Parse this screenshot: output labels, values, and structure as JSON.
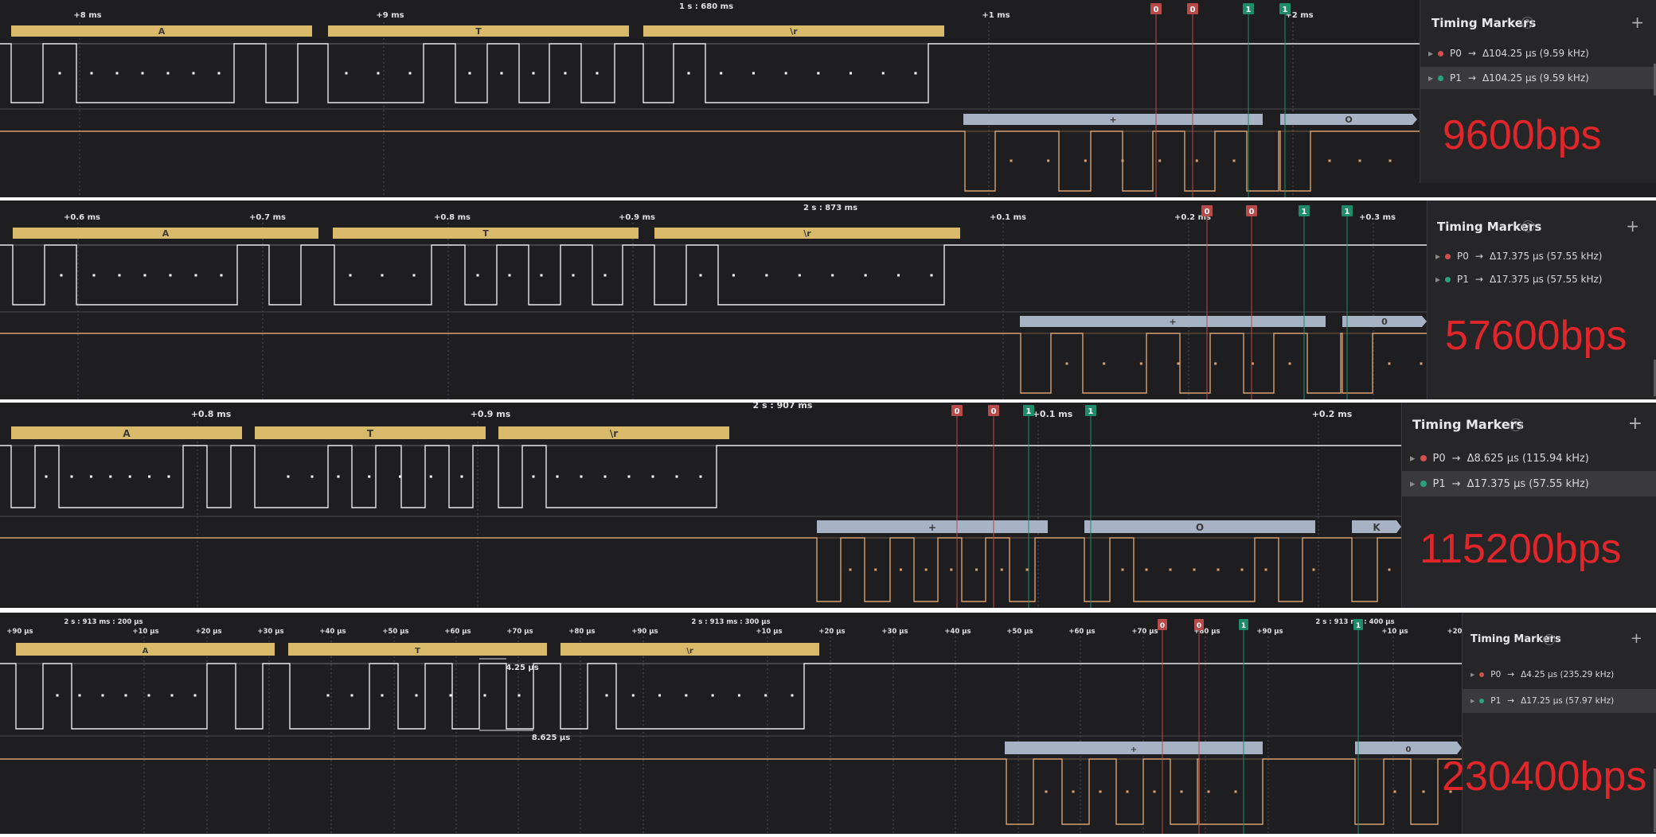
{
  "colors": {
    "panel_bg": "#1e1e20",
    "frame_bg": "#ffffff",
    "signal_white": "#e8e8e8",
    "signal_orange": "#d8a070",
    "decode_tx": "#d9b96a",
    "decode_rx": "#a7b3c4",
    "marker_p0": "#b84a4a",
    "marker_p1": "#1e8c6a",
    "rate_label": "#e0262b"
  },
  "panels": [
    {
      "id": "9600",
      "time_labels": [
        "+8 ms",
        "+9 ms",
        "1 s : 680 ms",
        "+1 ms",
        "+2 ms"
      ],
      "tx_bytes": [
        "A",
        "T",
        "\\r"
      ],
      "rx_bytes": [
        "+",
        "O"
      ],
      "marker_flags": [
        "0",
        "0",
        "1",
        "1"
      ],
      "sidebar": {
        "title": "Timing Markers",
        "markers": [
          {
            "name": "P0",
            "value": "Δ104.25 µs (9.59 kHz)",
            "color": "#d05050",
            "selected": false
          },
          {
            "name": "P1",
            "value": "Δ104.25 µs (9.59 kHz)",
            "color": "#2aa37a",
            "selected": true
          }
        ]
      },
      "rate_label": "9600bps"
    },
    {
      "id": "57600",
      "time_labels": [
        "+0.6 ms",
        "+0.7 ms",
        "+0.8 ms",
        "+0.9 ms",
        "2 s : 873 ms",
        "+0.1 ms",
        "+0.2 ms",
        "+0.3 ms"
      ],
      "tx_bytes": [
        "A",
        "T",
        "\\r"
      ],
      "rx_bytes": [
        "+",
        "0"
      ],
      "marker_flags": [
        "0",
        "0",
        "1",
        "1"
      ],
      "sidebar": {
        "title": "Timing Markers",
        "markers": [
          {
            "name": "P0",
            "value": "Δ17.375 µs (57.55 kHz)",
            "color": "#d05050",
            "selected": false
          },
          {
            "name": "P1",
            "value": "Δ17.375 µs (57.55 kHz)",
            "color": "#2aa37a",
            "selected": false
          }
        ]
      },
      "rate_label": "57600bps"
    },
    {
      "id": "115200",
      "time_labels": [
        "+0.8 ms",
        "+0.9 ms",
        "2 s : 907 ms",
        "+0.1 ms",
        "+0.2 ms"
      ],
      "tx_bytes": [
        "A",
        "T",
        "\\r"
      ],
      "rx_bytes": [
        "+",
        "O",
        "K"
      ],
      "marker_flags": [
        "0",
        "0",
        "1",
        "1"
      ],
      "sidebar": {
        "title": "Timing Markers",
        "markers": [
          {
            "name": "P0",
            "value": "Δ8.625 µs (115.94 kHz)",
            "color": "#d05050",
            "selected": false
          },
          {
            "name": "P1",
            "value": "Δ17.375 µs (57.55 kHz)",
            "color": "#2aa37a",
            "selected": true
          }
        ]
      },
      "rate_label": "115200bps"
    },
    {
      "id": "230400",
      "time_labels": [
        "+90 µs",
        "2 s : 913 ms : 200 µs",
        "+10 µs",
        "+20 µs",
        "+30 µs",
        "+40 µs",
        "+50 µs",
        "+60 µs",
        "+70 µs",
        "+80 µs",
        "+90 µs",
        "2 s : 913 ms : 300 µs",
        "+10 µs",
        "+20 µs",
        "+30 µs",
        "+40 µs",
        "+50 µs",
        "+60 µs",
        "+70 µs",
        "+80 µs",
        "+90 µs",
        "2 s : 913 ms : 400 µs",
        "+10 µs",
        "+20"
      ],
      "tx_bytes": [
        "A",
        "T",
        "\\r"
      ],
      "rx_bytes": [
        "+",
        "0"
      ],
      "marker_flags": [
        "0",
        "0",
        "1",
        "1"
      ],
      "measurements": [
        "4.25 µs",
        "8.625 µs"
      ],
      "sidebar": {
        "title": "Timing Markers",
        "markers": [
          {
            "name": "P0",
            "value": "Δ4.25 µs (235.29 kHz)",
            "color": "#d05050",
            "selected": false
          },
          {
            "name": "P1",
            "value": "Δ17.25 µs (57.97 kHz)",
            "color": "#2aa37a",
            "selected": true
          }
        ]
      },
      "rate_label": "230400bps"
    }
  ]
}
